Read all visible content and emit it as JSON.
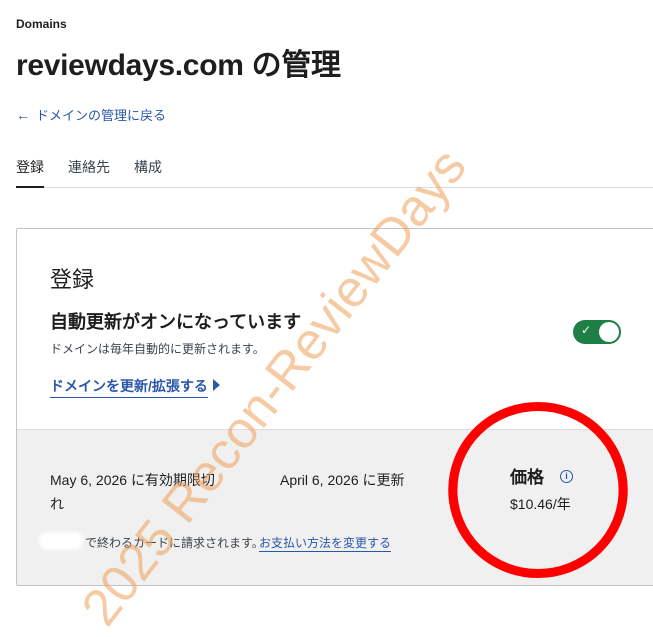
{
  "header": {
    "eyebrow": "Domains",
    "title": "reviewdays.com の管理",
    "back_link": "ドメインの管理に戻る"
  },
  "tabs": [
    {
      "label": "登録",
      "active": true
    },
    {
      "label": "連絡先",
      "active": false
    },
    {
      "label": "構成",
      "active": false
    }
  ],
  "registration": {
    "section_title": "登録",
    "auto_renew_title": "自動更新がオンになっています",
    "auto_renew_desc": "ドメインは毎年自動的に更新されます。",
    "auto_renew_enabled": true,
    "renew_link": "ドメインを更新/拡張する"
  },
  "billing": {
    "expiry_line1": "May 6, 2026 に有効期限切",
    "expiry_line2": "れ",
    "renew_date": "April 6, 2026 に更新",
    "card_charge": "で終わるカードに請求されます。",
    "change_payment_link": "お支払い方法を変更する",
    "price_label": "価格",
    "price_value": "$10.46/年"
  },
  "watermark": "2025 Recon-ReviewDays",
  "colors": {
    "link": "#2b57a8",
    "toggle_on": "#1d7f45",
    "annotation": "#ff0000",
    "watermark": "#eea05a"
  }
}
